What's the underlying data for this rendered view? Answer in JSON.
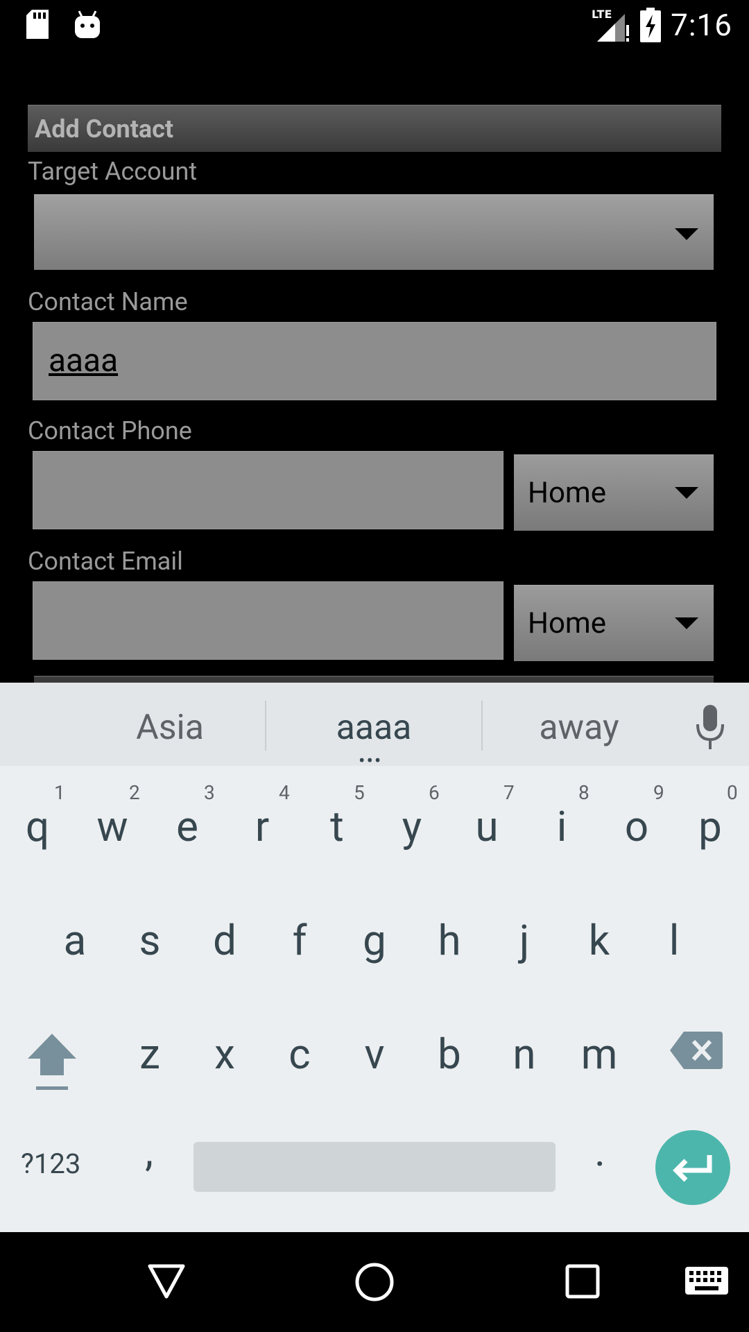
{
  "status_bar": {
    "time": "7:16",
    "network": "LTE",
    "icons": [
      "sd-card-icon",
      "android-debug-icon",
      "lte-signal-icon",
      "battery-charging-icon"
    ]
  },
  "form": {
    "title": "Add Contact",
    "target_account_label": "Target Account",
    "target_account_value": "",
    "contact_name_label": "Contact Name",
    "contact_name_value": "aaaa",
    "contact_phone_label": "Contact Phone",
    "contact_phone_value": "",
    "phone_type": "Home",
    "contact_email_label": "Contact Email",
    "contact_email_value": "",
    "email_type": "Home"
  },
  "keyboard": {
    "suggestions": [
      "Asia",
      "aaaa",
      "away"
    ],
    "row1": [
      "q",
      "w",
      "e",
      "r",
      "t",
      "y",
      "u",
      "i",
      "o",
      "p"
    ],
    "row1_hints": [
      "1",
      "2",
      "3",
      "4",
      "5",
      "6",
      "7",
      "8",
      "9",
      "0"
    ],
    "row2": [
      "a",
      "s",
      "d",
      "f",
      "g",
      "h",
      "j",
      "k",
      "l"
    ],
    "row3": [
      "z",
      "x",
      "c",
      "v",
      "b",
      "n",
      "m"
    ],
    "symbols_key": "?123",
    "comma_key": ",",
    "period_key": "."
  },
  "colors": {
    "accent_enter": "#4db6ac",
    "keyboard_bg": "#eceff1",
    "key_text": "#37474f"
  }
}
